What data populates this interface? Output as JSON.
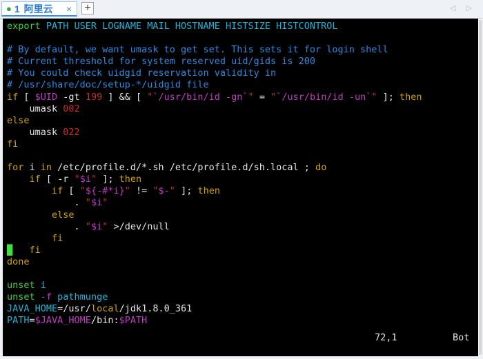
{
  "tab": {
    "index": "1",
    "name": "阿里云",
    "close": "×",
    "add": "+",
    "nav": "◁ ▷"
  },
  "lines": [
    [
      [
        "export ",
        "green"
      ],
      [
        "PATH USER LOGNAME MAIL HOSTNAME HISTSIZE HISTCONTROL",
        "cyan"
      ]
    ],
    [],
    [
      [
        "# By default, we want umask to get set. This sets it for login shell",
        "blue"
      ]
    ],
    [
      [
        "# Current threshold for system reserved uid/gids is 200",
        "blue"
      ]
    ],
    [
      [
        "# You could check uidgid reservation validity in",
        "blue"
      ]
    ],
    [
      [
        "# /usr/share/doc/setup-*/uidgid file",
        "blue"
      ]
    ],
    [
      [
        "if",
        "yellow"
      ],
      [
        " [ ",
        "white"
      ],
      [
        "$UID",
        "magenta"
      ],
      [
        " -gt ",
        "white"
      ],
      [
        "199",
        "red"
      ],
      [
        " ] && [ ",
        "white"
      ],
      [
        "\"",
        "red"
      ],
      [
        "`/usr/bin/id -gn`",
        "magenta"
      ],
      [
        "\"",
        "red"
      ],
      [
        " = ",
        "white"
      ],
      [
        "\"",
        "red"
      ],
      [
        "`/usr/bin/id -un`",
        "magenta"
      ],
      [
        "\"",
        "red"
      ],
      [
        " ]; ",
        "white"
      ],
      [
        "then",
        "yellow"
      ]
    ],
    [
      [
        "    umask ",
        "white"
      ],
      [
        "002",
        "red"
      ]
    ],
    [
      [
        "else",
        "yellow"
      ]
    ],
    [
      [
        "    umask ",
        "white"
      ],
      [
        "022",
        "red"
      ]
    ],
    [
      [
        "fi",
        "yellow"
      ]
    ],
    [],
    [
      [
        "for",
        "yellow"
      ],
      [
        " i ",
        "white"
      ],
      [
        "in",
        "yellow"
      ],
      [
        " /etc/profile.d/*.sh /etc/profile.d/sh.local ; ",
        "white"
      ],
      [
        "do",
        "yellow"
      ]
    ],
    [
      [
        "    ",
        "white"
      ],
      [
        "if",
        "yellow"
      ],
      [
        " [ -r ",
        "white"
      ],
      [
        "\"",
        "red"
      ],
      [
        "$i",
        "magenta"
      ],
      [
        "\"",
        "red"
      ],
      [
        " ]; ",
        "white"
      ],
      [
        "then",
        "yellow"
      ]
    ],
    [
      [
        "        ",
        "white"
      ],
      [
        "if",
        "yellow"
      ],
      [
        " [ ",
        "white"
      ],
      [
        "\"",
        "red"
      ],
      [
        "${-#*i}",
        "magenta"
      ],
      [
        "\"",
        "red"
      ],
      [
        " != ",
        "white"
      ],
      [
        "\"",
        "red"
      ],
      [
        "$-",
        "magenta"
      ],
      [
        "\"",
        "red"
      ],
      [
        " ]; ",
        "white"
      ],
      [
        "then",
        "yellow"
      ]
    ],
    [
      [
        "            . ",
        "white"
      ],
      [
        "\"",
        "red"
      ],
      [
        "$i",
        "magenta"
      ],
      [
        "\"",
        "red"
      ]
    ],
    [
      [
        "        ",
        "white"
      ],
      [
        "else",
        "yellow"
      ]
    ],
    [
      [
        "            . ",
        "white"
      ],
      [
        "\"",
        "red"
      ],
      [
        "$i",
        "magenta"
      ],
      [
        "\"",
        "red"
      ],
      [
        " >/dev/null",
        "white"
      ]
    ],
    [
      [
        "        ",
        "white"
      ],
      [
        "fi",
        "yellow"
      ]
    ],
    [
      [
        "█",
        "cursor"
      ],
      [
        "   ",
        "white"
      ],
      [
        "fi",
        "yellow"
      ]
    ],
    [
      [
        "done",
        "yellow"
      ]
    ],
    [],
    [
      [
        "unset ",
        "green"
      ],
      [
        "i",
        "cyan"
      ]
    ],
    [
      [
        "unset ",
        "green"
      ],
      [
        "-f ",
        "magenta"
      ],
      [
        "pathmunge",
        "cyan"
      ]
    ],
    [
      [
        "JAVA_HOME",
        "cyan"
      ],
      [
        "=/usr/",
        "white"
      ],
      [
        "local",
        "yellow"
      ],
      [
        "/jdk1.8.0_361",
        "white"
      ]
    ],
    [
      [
        "PATH",
        "cyan"
      ],
      [
        "=",
        "white"
      ],
      [
        "$JAVA_HOME",
        "magenta"
      ],
      [
        "/bin:",
        "white"
      ],
      [
        "$PATH",
        "magenta"
      ]
    ]
  ],
  "status": {
    "position": "72,1",
    "scroll": "Bot"
  },
  "colors": {
    "green": "#3fd13f",
    "cyan": "#1fb5d8",
    "blue": "#2a8be3",
    "yellow": "#d0a30c",
    "red": "#cc2b2b",
    "magenta": "#c03cc2",
    "white": "#e6e6e6",
    "cursor": "#3fe13f"
  }
}
